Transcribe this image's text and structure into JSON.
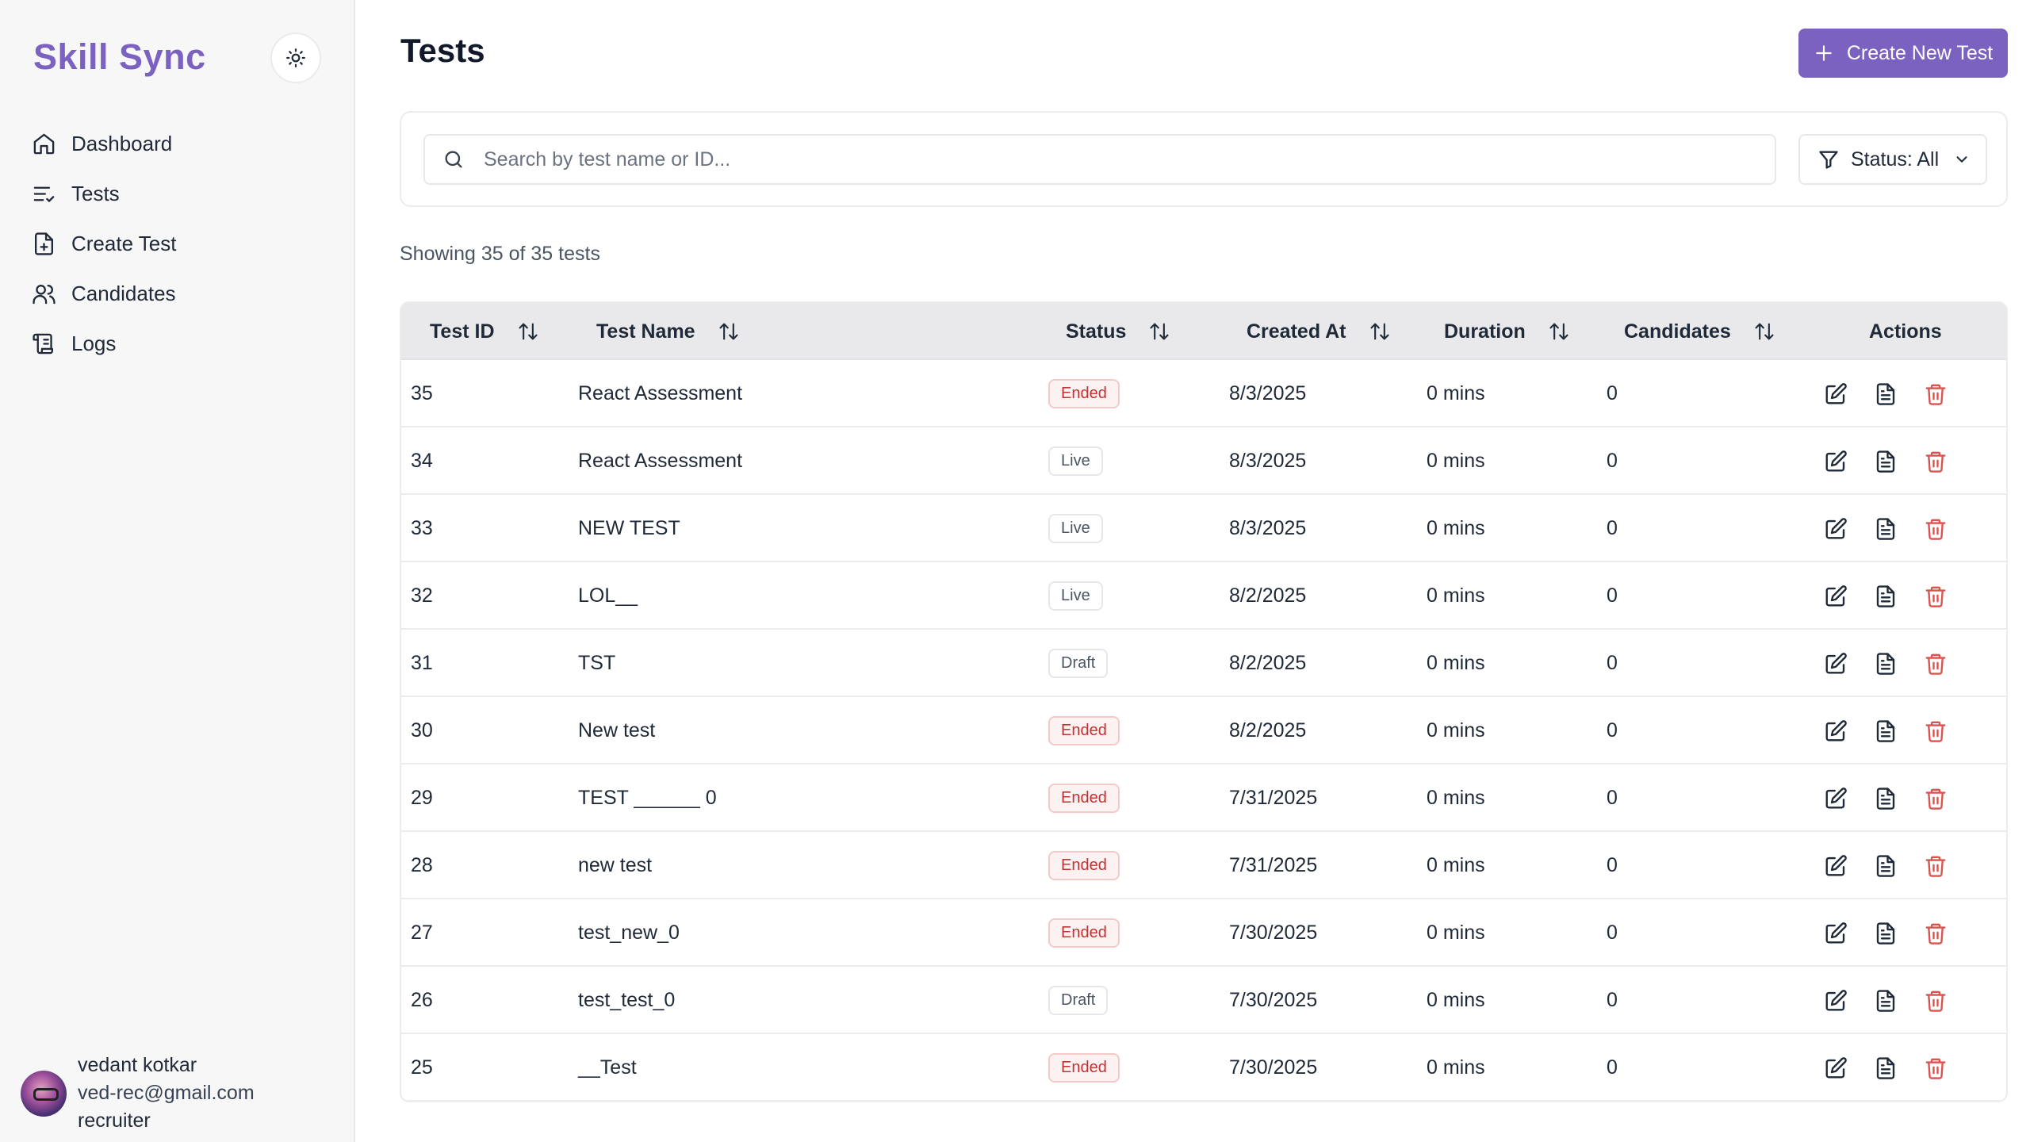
{
  "sidebar": {
    "brand": "Skill Sync",
    "theme_icon": "sun-icon",
    "items": [
      {
        "label": "Dashboard",
        "icon": "home-icon"
      },
      {
        "label": "Tests",
        "icon": "list-check-icon"
      },
      {
        "label": "Create Test",
        "icon": "file-plus-icon"
      },
      {
        "label": "Candidates",
        "icon": "users-icon"
      },
      {
        "label": "Logs",
        "icon": "scroll-icon"
      }
    ],
    "user": {
      "name": "vedant kotkar",
      "email": "ved-rec@gmail.com",
      "role": "recruiter"
    }
  },
  "header": {
    "title": "Tests",
    "create_label": "Create New Test"
  },
  "filters": {
    "search_placeholder": "Search by test name or ID...",
    "status_label": "Status: All"
  },
  "summary": "Showing 35 of 35 tests",
  "table": {
    "columns": [
      "Test ID",
      "Test Name",
      "Status",
      "Created At",
      "Duration",
      "Candidates",
      "Actions"
    ],
    "rows": [
      {
        "id": "35",
        "name": "React Assessment",
        "status": "Ended",
        "created": "8/3/2025",
        "duration": "0 mins",
        "candidates": "0"
      },
      {
        "id": "34",
        "name": "React Assessment",
        "status": "Live",
        "created": "8/3/2025",
        "duration": "0 mins",
        "candidates": "0"
      },
      {
        "id": "33",
        "name": "NEW TEST",
        "status": "Live",
        "created": "8/3/2025",
        "duration": "0 mins",
        "candidates": "0"
      },
      {
        "id": "32",
        "name": "LOL__",
        "status": "Live",
        "created": "8/2/2025",
        "duration": "0 mins",
        "candidates": "0"
      },
      {
        "id": "31",
        "name": "TST",
        "status": "Draft",
        "created": "8/2/2025",
        "duration": "0 mins",
        "candidates": "0"
      },
      {
        "id": "30",
        "name": "New test",
        "status": "Ended",
        "created": "8/2/2025",
        "duration": "0 mins",
        "candidates": "0"
      },
      {
        "id": "29",
        "name": "TEST ______ 0",
        "status": "Ended",
        "created": "7/31/2025",
        "duration": "0 mins",
        "candidates": "0"
      },
      {
        "id": "28",
        "name": "new test",
        "status": "Ended",
        "created": "7/31/2025",
        "duration": "0 mins",
        "candidates": "0"
      },
      {
        "id": "27",
        "name": "test_new_0",
        "status": "Ended",
        "created": "7/30/2025",
        "duration": "0 mins",
        "candidates": "0"
      },
      {
        "id": "26",
        "name": "test_test_0",
        "status": "Draft",
        "created": "7/30/2025",
        "duration": "0 mins",
        "candidates": "0"
      },
      {
        "id": "25",
        "name": "__Test",
        "status": "Ended",
        "created": "7/30/2025",
        "duration": "0 mins",
        "candidates": "0"
      }
    ]
  },
  "colors": {
    "brand": "#7b61c0",
    "danger": "#c53030",
    "header_bg": "#e9e9ec"
  }
}
